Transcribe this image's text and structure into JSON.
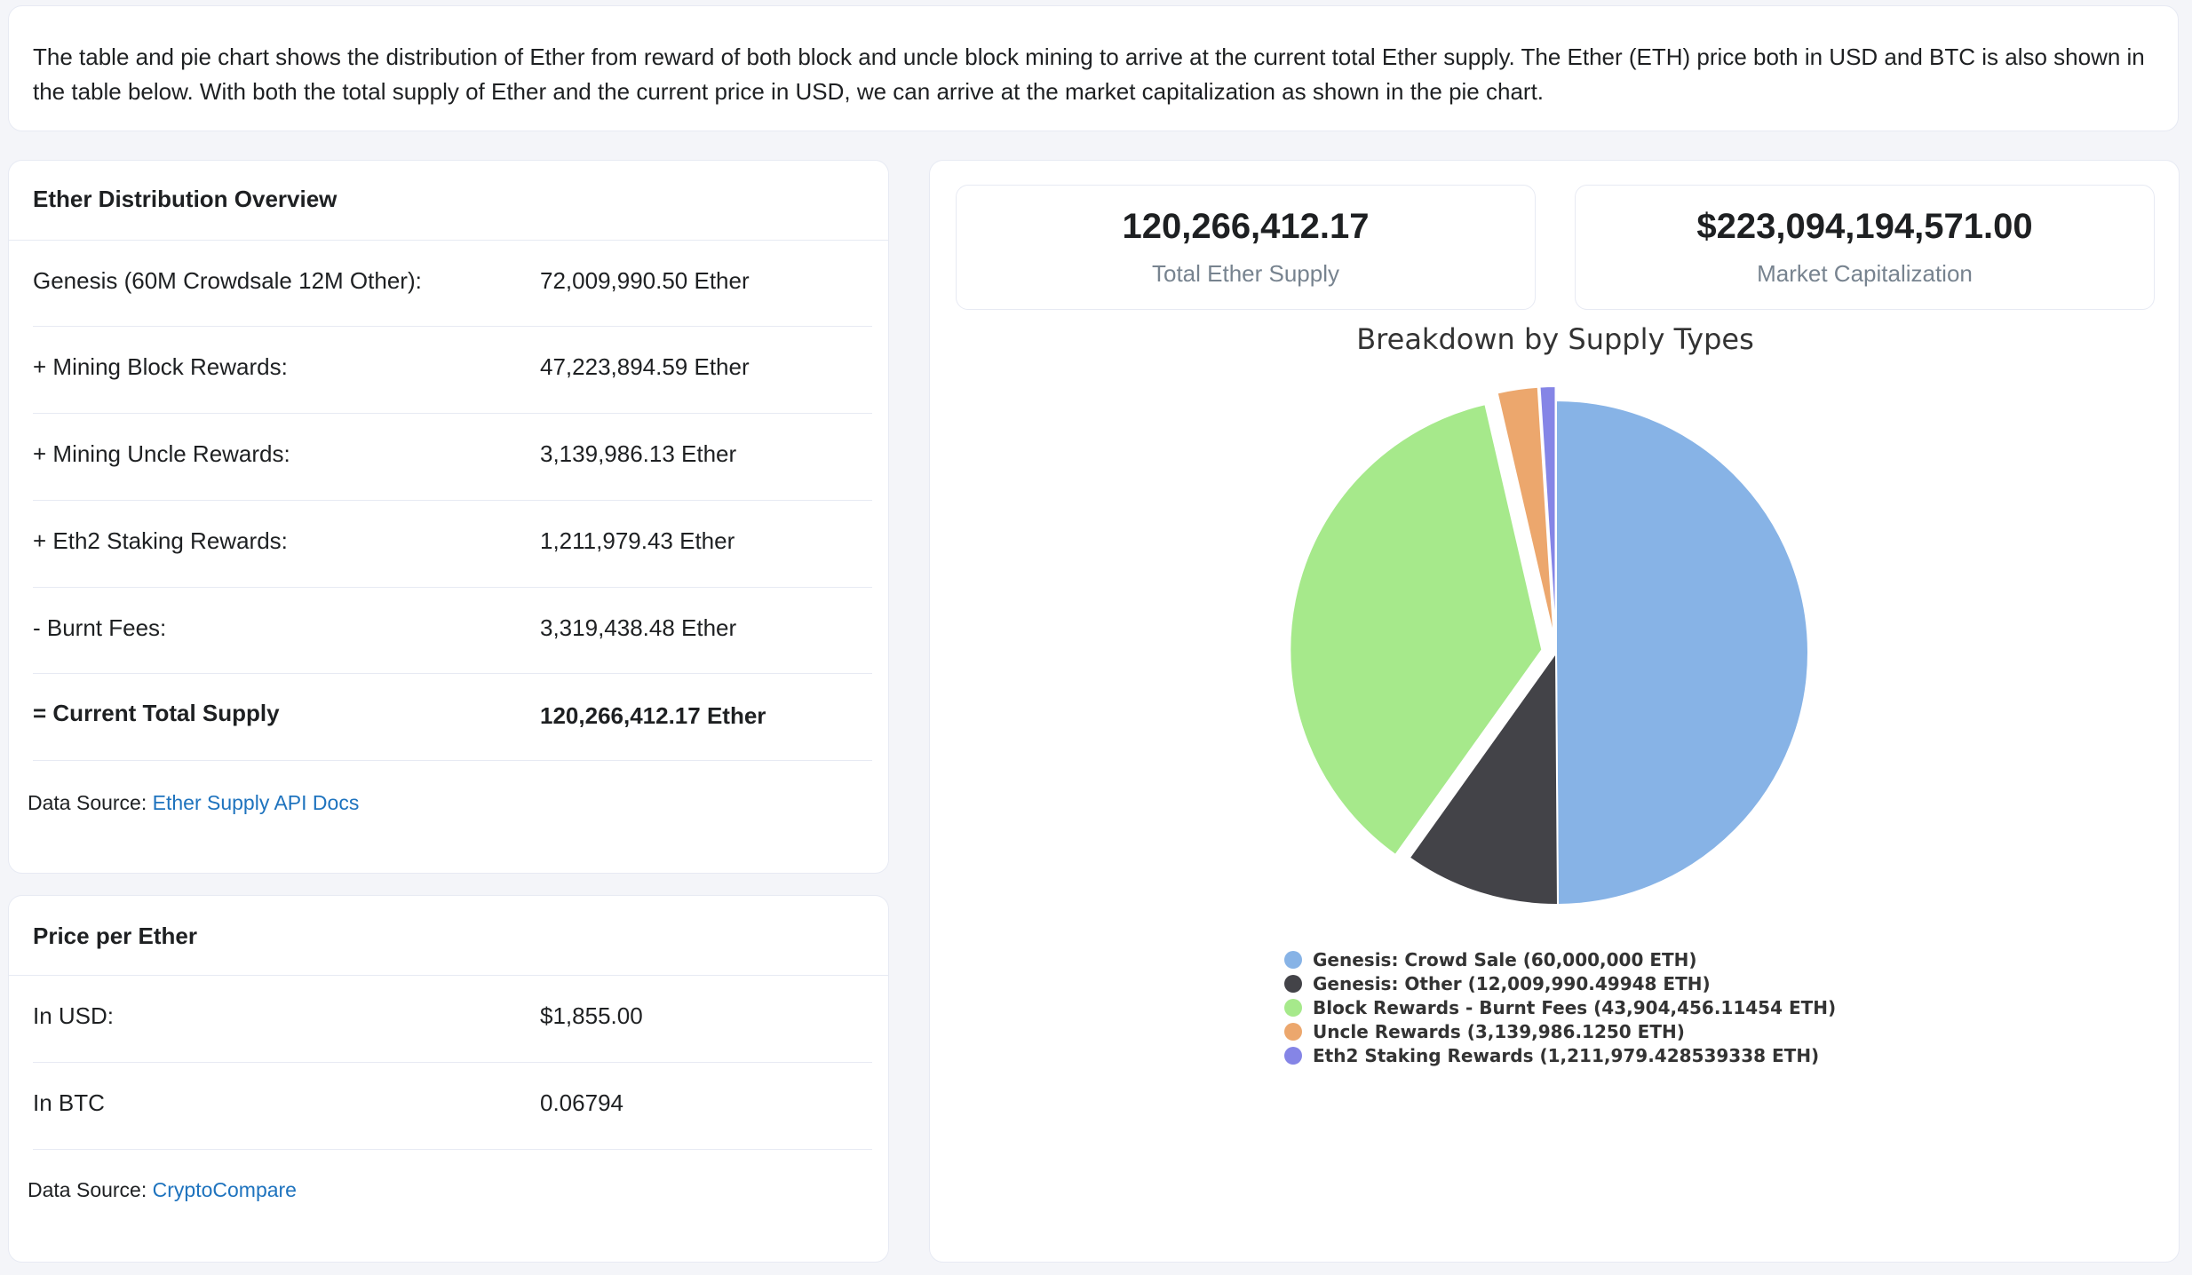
{
  "intro": "The table and pie chart shows the distribution of Ether from reward of both block and uncle block mining to arrive at the current total Ether supply. The Ether (ETH) price both in USD and BTC is also shown in the table below. With both the total supply of Ether and the current price in USD, we can arrive at the market capitalization as shown in the pie chart.",
  "distribution": {
    "title": "Ether Distribution Overview",
    "rows": [
      {
        "label": "Genesis (60M Crowdsale 12M Other):",
        "value": "72,009,990.50 Ether"
      },
      {
        "label": "+ Mining Block Rewards:",
        "value": "47,223,894.59 Ether"
      },
      {
        "label": "+ Mining Uncle Rewards:",
        "value": "3,139,986.13 Ether"
      },
      {
        "label": "+ Eth2 Staking Rewards:",
        "value": "1,211,979.43 Ether"
      },
      {
        "label": "- Burnt Fees:",
        "value": "3,319,438.48 Ether"
      },
      {
        "label": "= Current Total Supply",
        "value": "120,266,412.17 Ether"
      }
    ],
    "source_prefix": "Data Source: ",
    "source_link": "Ether Supply API Docs"
  },
  "price": {
    "title": "Price per Ether",
    "rows": [
      {
        "label": "In USD:",
        "value": "$1,855.00"
      },
      {
        "label": "In BTC",
        "value": "0.06794"
      }
    ],
    "source_prefix": "Data Source: ",
    "source_link": "CryptoCompare"
  },
  "stats": {
    "total_supply": "120,266,412.17",
    "total_supply_label": "Total Ether Supply",
    "market_cap": "$223,094,194,571.00",
    "market_cap_label": "Market Capitalization"
  },
  "chart_data": {
    "type": "pie",
    "title": "Breakdown by Supply Types",
    "categories": [
      "Genesis: Crowd Sale (60,000,000 ETH)",
      "Genesis: Other (12,009,990.49948 ETH)",
      "Block Rewards - Burnt Fees (43,904,456.11454 ETH)",
      "Uncle Rewards (3,139,986.1250 ETH)",
      "Eth2 Staking Rewards (1,211,979.428539338 ETH)"
    ],
    "values": [
      60000000,
      12009990.49948,
      43904456.11454,
      3139986.125,
      1211979.428539338
    ],
    "colors": [
      "#87b3e6",
      "#434348",
      "#a6e98b",
      "#eca76d",
      "#8585e6"
    ],
    "sliced": [
      false,
      false,
      true,
      true,
      true
    ],
    "legend_position": "bottom"
  },
  "colors": {
    "link": "#1e73be",
    "border": "#e7eaf3",
    "muted": "#77838f",
    "background": "#f4f5f9"
  }
}
